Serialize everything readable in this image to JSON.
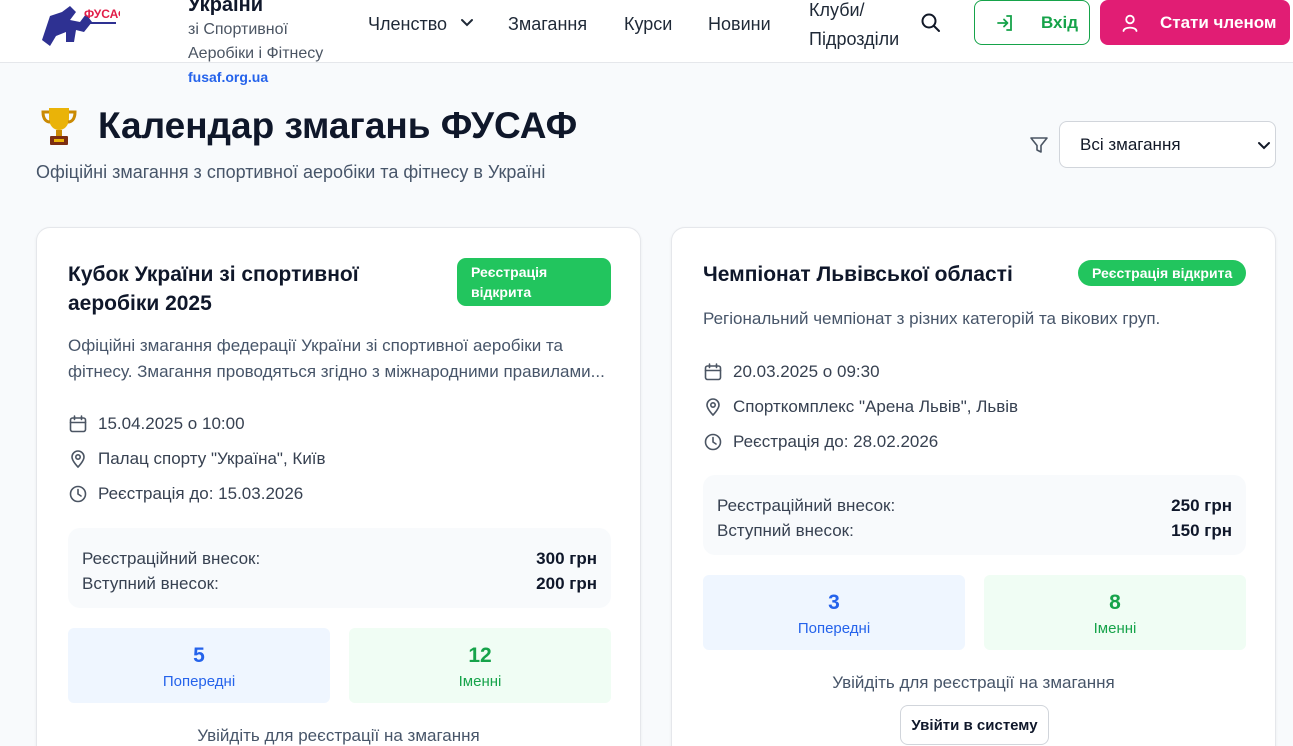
{
  "header": {
    "brand_title": "України",
    "brand_subtitle": "зі Спортивної Аеробіки і Фітнесу",
    "brand_url": "fusaf.org.ua",
    "logo_text": "ФУСАФ",
    "nav": [
      "Членство",
      "Змагання",
      "Курси",
      "Новини",
      "Клуби/ Підрозділи"
    ],
    "login_label": "Вхід",
    "join_label": "Стати членом"
  },
  "page": {
    "title": "Календар змагань ФУСАФ",
    "subtitle": "Офіційні змагання з спортивної аеробіки та фітнесу в Україні",
    "filter_selected": "Всі змагання"
  },
  "cards": [
    {
      "title": "Кубок України зі спортивної аеробіки 2025",
      "badge": "Реєстрація відкрита",
      "description": "Офіційні змагання федерації України зі спортивної аеробіки та фітнесу. Змагання проводяться згідно з міжнародними правилами...",
      "date": "15.04.2025 о 10:00",
      "location": "Палац спорту \"Україна\", Київ",
      "registration_until": "Реєстрація до: 15.03.2026",
      "fee_registration_label": "Реєстраційний внесок:",
      "fee_registration": "300 грн",
      "fee_entry_label": "Вступний внесок:",
      "fee_entry": "200 грн",
      "preliminary_count": "5",
      "preliminary_label": "Попередні",
      "named_count": "12",
      "named_label": "Іменні",
      "login_hint": "Увійдіть для реєстрації на змагання"
    },
    {
      "title": "Чемпіонат Львівської області",
      "badge": "Реєстрація відкрита",
      "description": "Регіональний чемпіонат з різних категорій та вікових груп.",
      "date": "20.03.2025 о 09:30",
      "location": "Спорткомплекс \"Арена Львів\", Львів",
      "registration_until": "Реєстрація до: 28.02.2026",
      "fee_registration_label": "Реєстраційний внесок:",
      "fee_registration": "250 грн",
      "fee_entry_label": "Вступний внесок:",
      "fee_entry": "150 грн",
      "preliminary_count": "3",
      "preliminary_label": "Попередні",
      "named_count": "8",
      "named_label": "Іменні",
      "login_hint": "Увійдіть для реєстрації на змагання",
      "login_button": "Увійти в систему"
    }
  ]
}
